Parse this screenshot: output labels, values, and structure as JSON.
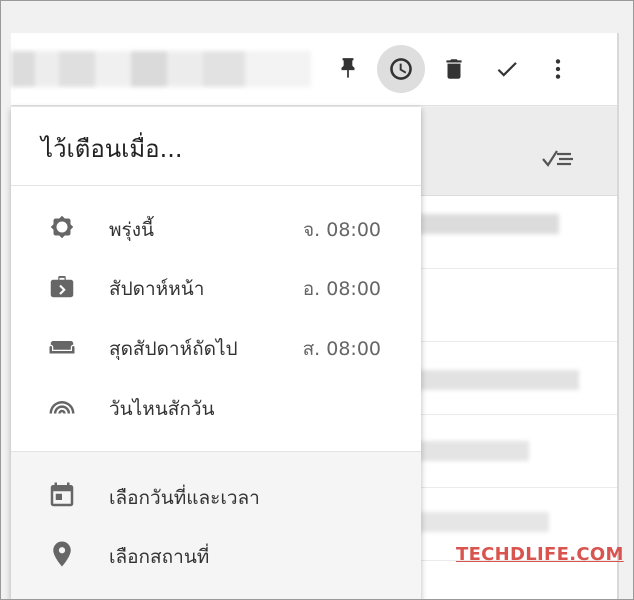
{
  "menu": {
    "title": "ไว้เตือนเมื่อ...",
    "items": [
      {
        "label": "พรุ่งนี้",
        "time": "จ. 08:00",
        "icon": "sun-icon"
      },
      {
        "label": "สัปดาห์หน้า",
        "time": "อ. 08:00",
        "icon": "briefcase-icon"
      },
      {
        "label": "สุดสัปดาห์ถัดไป",
        "time": "ส. 08:00",
        "icon": "couch-icon"
      },
      {
        "label": "วันไหนสักวัน",
        "time": "",
        "icon": "rainbow-icon"
      }
    ],
    "extra_items": [
      {
        "label": "เลือกวันที่และเวลา",
        "icon": "calendar-icon"
      },
      {
        "label": "เลือกสถานที่",
        "icon": "location-pin-icon"
      }
    ]
  },
  "toolbar": {
    "icons": [
      "pin-icon",
      "snooze-clock-icon",
      "trash-icon",
      "check-icon",
      "more-vert-icon"
    ],
    "active": "snooze-clock-icon"
  },
  "watermark": "TECHDLIFE.COM",
  "colors": {
    "watermark": "#d9534f",
    "menu_bg": "#ffffff",
    "icon": "#666666"
  }
}
